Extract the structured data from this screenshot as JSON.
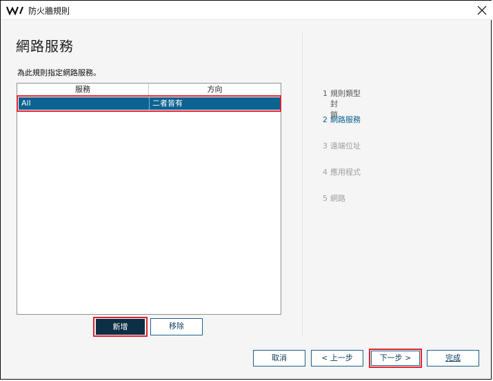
{
  "window": {
    "title": "防火牆規則"
  },
  "page": {
    "heading": "網路服務",
    "description": "為此規則指定網路服務。"
  },
  "table": {
    "columns": [
      "服務",
      "方向"
    ],
    "rows": [
      {
        "service": "All",
        "direction": "二者皆有",
        "selected": true
      }
    ]
  },
  "table_actions": {
    "add_label": "新增",
    "remove_label": "移除"
  },
  "steps": [
    {
      "num": "1",
      "label": "規則類型",
      "sub": "封鎖",
      "state": "done"
    },
    {
      "num": "2",
      "label": "網路服務",
      "state": "current"
    },
    {
      "num": "3",
      "label": "遠端位址",
      "state": "future"
    },
    {
      "num": "4",
      "label": "應用程式",
      "state": "future"
    },
    {
      "num": "5",
      "label": "網路",
      "state": "future"
    }
  ],
  "footer": {
    "cancel_label": "取消",
    "back_label": "< 上一步",
    "next_label": "下一步 >",
    "finish_label": "完成"
  },
  "colors": {
    "selection": "#0c6392",
    "highlight_outline": "#e0212e",
    "primary_dark": "#0d2f45",
    "current_step": "#0c6392",
    "future_step": "#9f9f9f"
  }
}
